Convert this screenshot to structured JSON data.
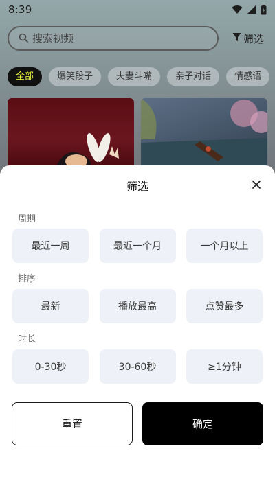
{
  "status_bar": {
    "time": "8:39",
    "icons": [
      "wifi-icon",
      "signal-icon",
      "battery-icon"
    ]
  },
  "search": {
    "placeholder": "搜索视频",
    "icon": "search-icon"
  },
  "filter_button": {
    "label": "筛选",
    "icon": "funnel-icon"
  },
  "categories": [
    {
      "label": "全部",
      "active": true
    },
    {
      "label": "爆笑段子",
      "active": false
    },
    {
      "label": "夫妻斗嘴",
      "active": false
    },
    {
      "label": "亲子对话",
      "active": false
    },
    {
      "label": "情感语",
      "active": false
    }
  ],
  "colors": {
    "active_chip_bg": "#111111",
    "active_chip_text": "#e8f03c",
    "option_bg": "#eef1f7",
    "confirm_bg": "#000000"
  },
  "filter_sheet": {
    "title": "筛选",
    "close_icon": "close-icon",
    "sections": [
      {
        "label": "周期",
        "options": [
          "最近一周",
          "最近一个月",
          "一个月以上"
        ]
      },
      {
        "label": "排序",
        "options": [
          "最新",
          "播放最高",
          "点赞最多"
        ]
      },
      {
        "label": "时长",
        "options": [
          "0-30秒",
          "30-60秒",
          "≥1分钟"
        ]
      }
    ],
    "reset_label": "重置",
    "confirm_label": "确定"
  }
}
